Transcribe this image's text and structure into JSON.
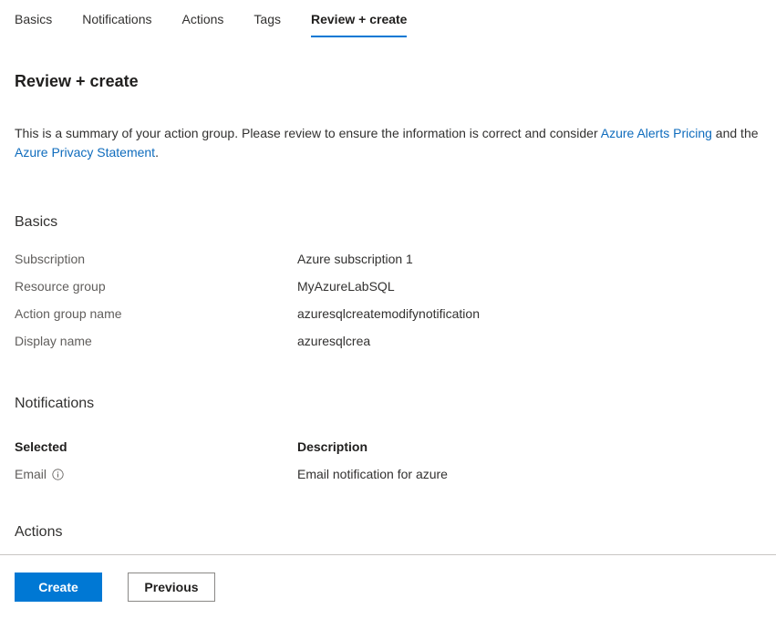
{
  "tabs": [
    {
      "label": "Basics",
      "active": false
    },
    {
      "label": "Notifications",
      "active": false
    },
    {
      "label": "Actions",
      "active": false
    },
    {
      "label": "Tags",
      "active": false
    },
    {
      "label": "Review + create",
      "active": true
    }
  ],
  "page": {
    "title": "Review + create",
    "intro": {
      "part1": "This is a summary of your action group. Please review to ensure the information is correct and consider ",
      "link1": "Azure Alerts Pricing",
      "part2": " and the ",
      "link2": "Azure Privacy Statement",
      "part3": "."
    }
  },
  "basics": {
    "section_title": "Basics",
    "rows": [
      {
        "key": "Subscription",
        "value": "Azure subscription 1"
      },
      {
        "key": "Resource group",
        "value": "MyAzureLabSQL"
      },
      {
        "key": "Action group name",
        "value": "azuresqlcreatemodifynotification"
      },
      {
        "key": "Display name",
        "value": "azuresqlcrea"
      }
    ]
  },
  "notifications": {
    "section_title": "Notifications",
    "headers": {
      "selected": "Selected",
      "description": "Description"
    },
    "rows": [
      {
        "selected": "Email",
        "description": "Email notification for azure"
      }
    ]
  },
  "actions": {
    "section_title": "Actions"
  },
  "footer": {
    "create_label": "Create",
    "previous_label": "Previous"
  },
  "colors": {
    "accent": "#0078d4",
    "link": "#0f6cbd",
    "label_gray": "#605e5c",
    "value_dark": "#323130",
    "divider": "#c8c6c4",
    "button_border": "#8a8886"
  }
}
